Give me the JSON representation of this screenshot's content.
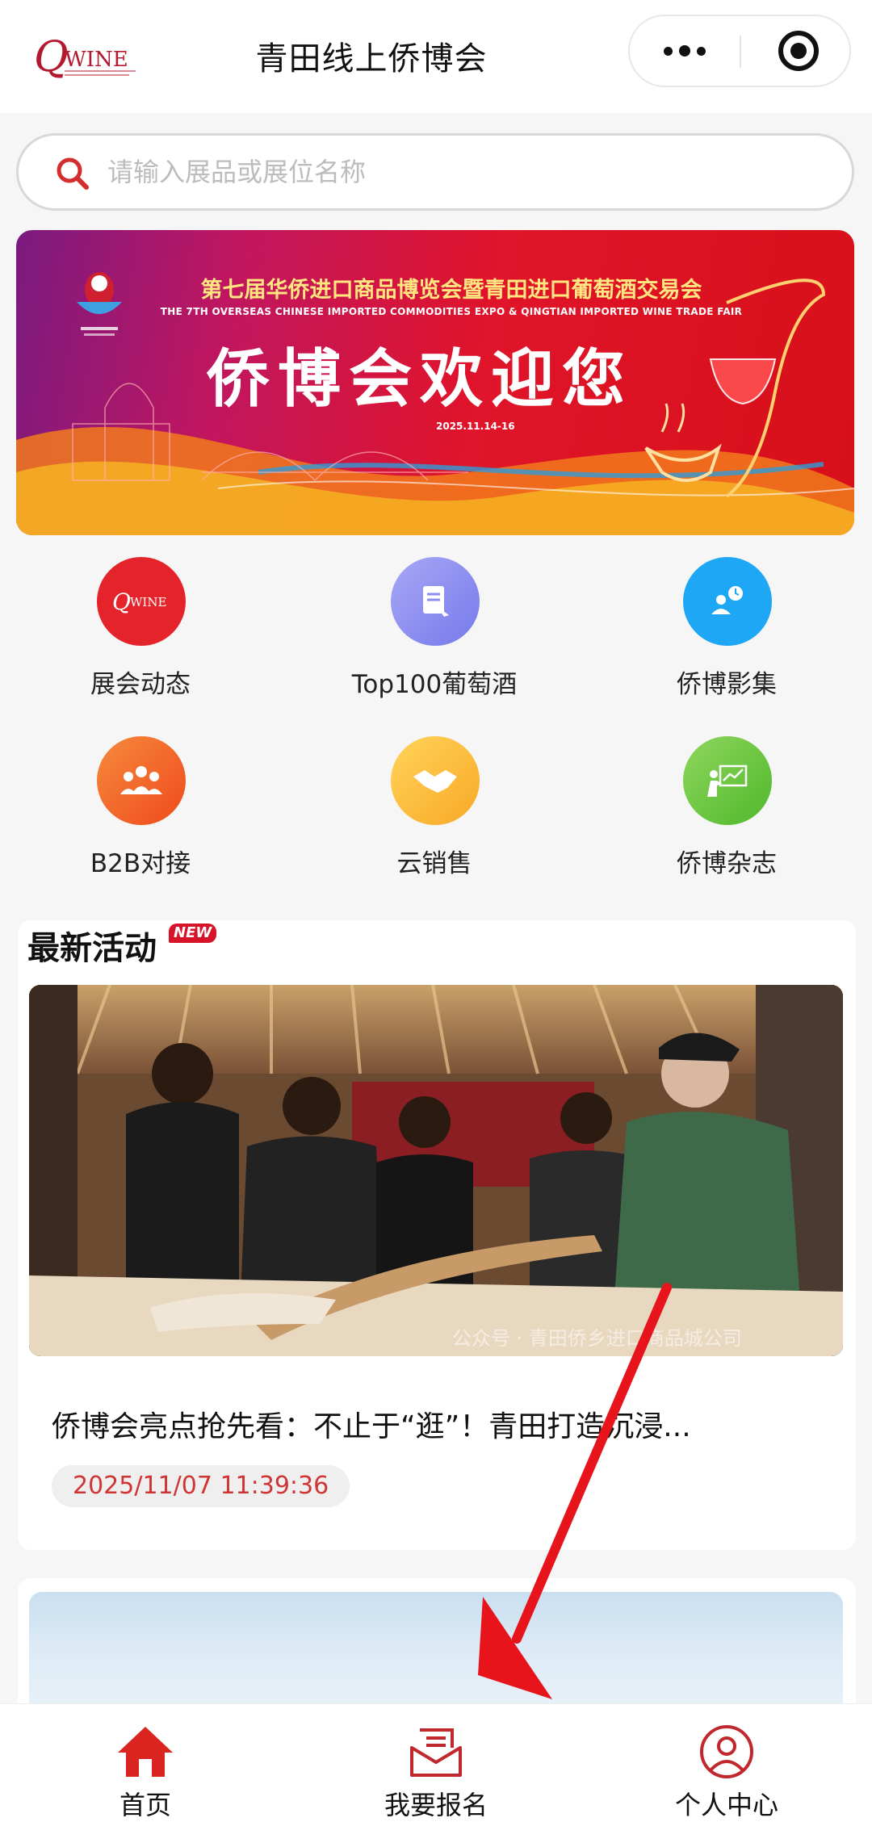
{
  "header": {
    "title": "青田线上侨博会",
    "logo_text": "QWINE"
  },
  "search": {
    "placeholder": "请输入展品或展位名称"
  },
  "banner": {
    "title_cn": "第七届华侨进口商品博览会暨青田进口葡萄酒交易会",
    "title_en": "THE 7TH OVERSEAS CHINESE IMPORTED COMMODITIES EXPO & QINGTIAN IMPORTED WINE TRADE FAIR",
    "headline": "侨博会欢迎您",
    "date": "2025.11.14-16"
  },
  "grid": {
    "items": [
      {
        "label": "展会动态",
        "icon": "qwine-logo-icon",
        "color": "#e5232b"
      },
      {
        "label": "Top100葡萄酒",
        "icon": "document-icon",
        "color": "#8b8ef0"
      },
      {
        "label": "侨博影集",
        "icon": "people-clock-icon",
        "color": "#1ea7f5"
      },
      {
        "label": "B2B对接",
        "icon": "group-icon",
        "color": "#f3622a"
      },
      {
        "label": "云销售",
        "icon": "handshake-icon",
        "color": "#fbbe2f"
      },
      {
        "label": "侨博杂志",
        "icon": "presentation-icon",
        "color": "#6cc63e"
      }
    ]
  },
  "activities": {
    "title": "最新活动",
    "badge": "NEW",
    "items": [
      {
        "title": "侨博会亮点抢先看：不止于“逛”！青田打造沉浸...",
        "date": "2025/11/07 11:39:36",
        "watermark": "公众号 · 青田侨乡进口商品城公司"
      }
    ]
  },
  "tabbar": {
    "items": [
      {
        "label": "首页",
        "icon": "home-icon"
      },
      {
        "label": "我要报名",
        "icon": "register-mail-icon"
      },
      {
        "label": "个人中心",
        "icon": "user-icon"
      }
    ]
  },
  "colors": {
    "accent_red": "#d7132a",
    "date_text": "#d03535",
    "annotation_arrow": "#e8141c"
  }
}
